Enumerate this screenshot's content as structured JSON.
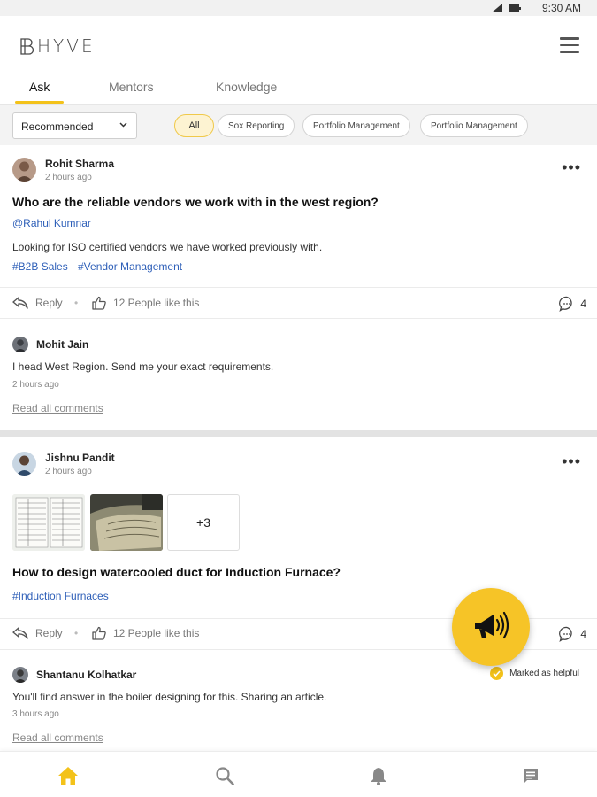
{
  "status_bar": {
    "time": "9:30 AM",
    "icons": [
      "signal-icon",
      "battery-icon"
    ]
  },
  "app": {
    "logo_text": "HYVE",
    "accent_color": "#f3c21a",
    "link_color": "#2e5fb8"
  },
  "tabs": [
    {
      "label": "Ask",
      "active": true
    },
    {
      "label": "Mentors",
      "active": false
    },
    {
      "label": "Knowledge",
      "active": false
    }
  ],
  "filters": {
    "sort_selected": "Recommended",
    "chips": [
      {
        "label": "All",
        "active": true
      },
      {
        "label": "Sox Reporting",
        "active": false
      },
      {
        "label": "Portfolio Management",
        "active": false
      },
      {
        "label": "Portfolio Management",
        "active": false
      }
    ]
  },
  "posts": [
    {
      "author": "Rohit Sharma",
      "time": "2 hours ago",
      "question": "Who are the reliable vendors we work with in the west region?",
      "mention": "@Rahul Kumnar",
      "body": "Looking for ISO certified vendors we have worked previously with.",
      "hashtags": [
        "#B2B Sales",
        "#Vendor Management"
      ],
      "reply_label": "Reply",
      "likes_label": "12 People like this",
      "comment_count": "4",
      "comment": {
        "author": "Mohit Jain",
        "text": "I head West Region. Send me your exact requirements.",
        "time": "2 hours ago"
      },
      "read_all_label": "Read all comments"
    },
    {
      "author": "Jishnu Pandit",
      "time": "2 hours ago",
      "extra_images_label": "+3",
      "question": "How to design watercooled duct for Induction Furnace?",
      "hashtags": [
        "#Induction Furnaces"
      ],
      "reply_label": "Reply",
      "likes_label": "12 People like this",
      "comment_count": "4",
      "comment": {
        "author": "Shantanu Kolhatkar",
        "text": "You'll find answer in the boiler designing for this. Sharing an article.",
        "time": "3 hours ago",
        "helpful_label": "Marked as helpful"
      },
      "read_all_label": "Read all comments"
    }
  ],
  "bottom_nav": [
    "home-icon",
    "search-icon",
    "bell-icon",
    "chat-icon"
  ]
}
